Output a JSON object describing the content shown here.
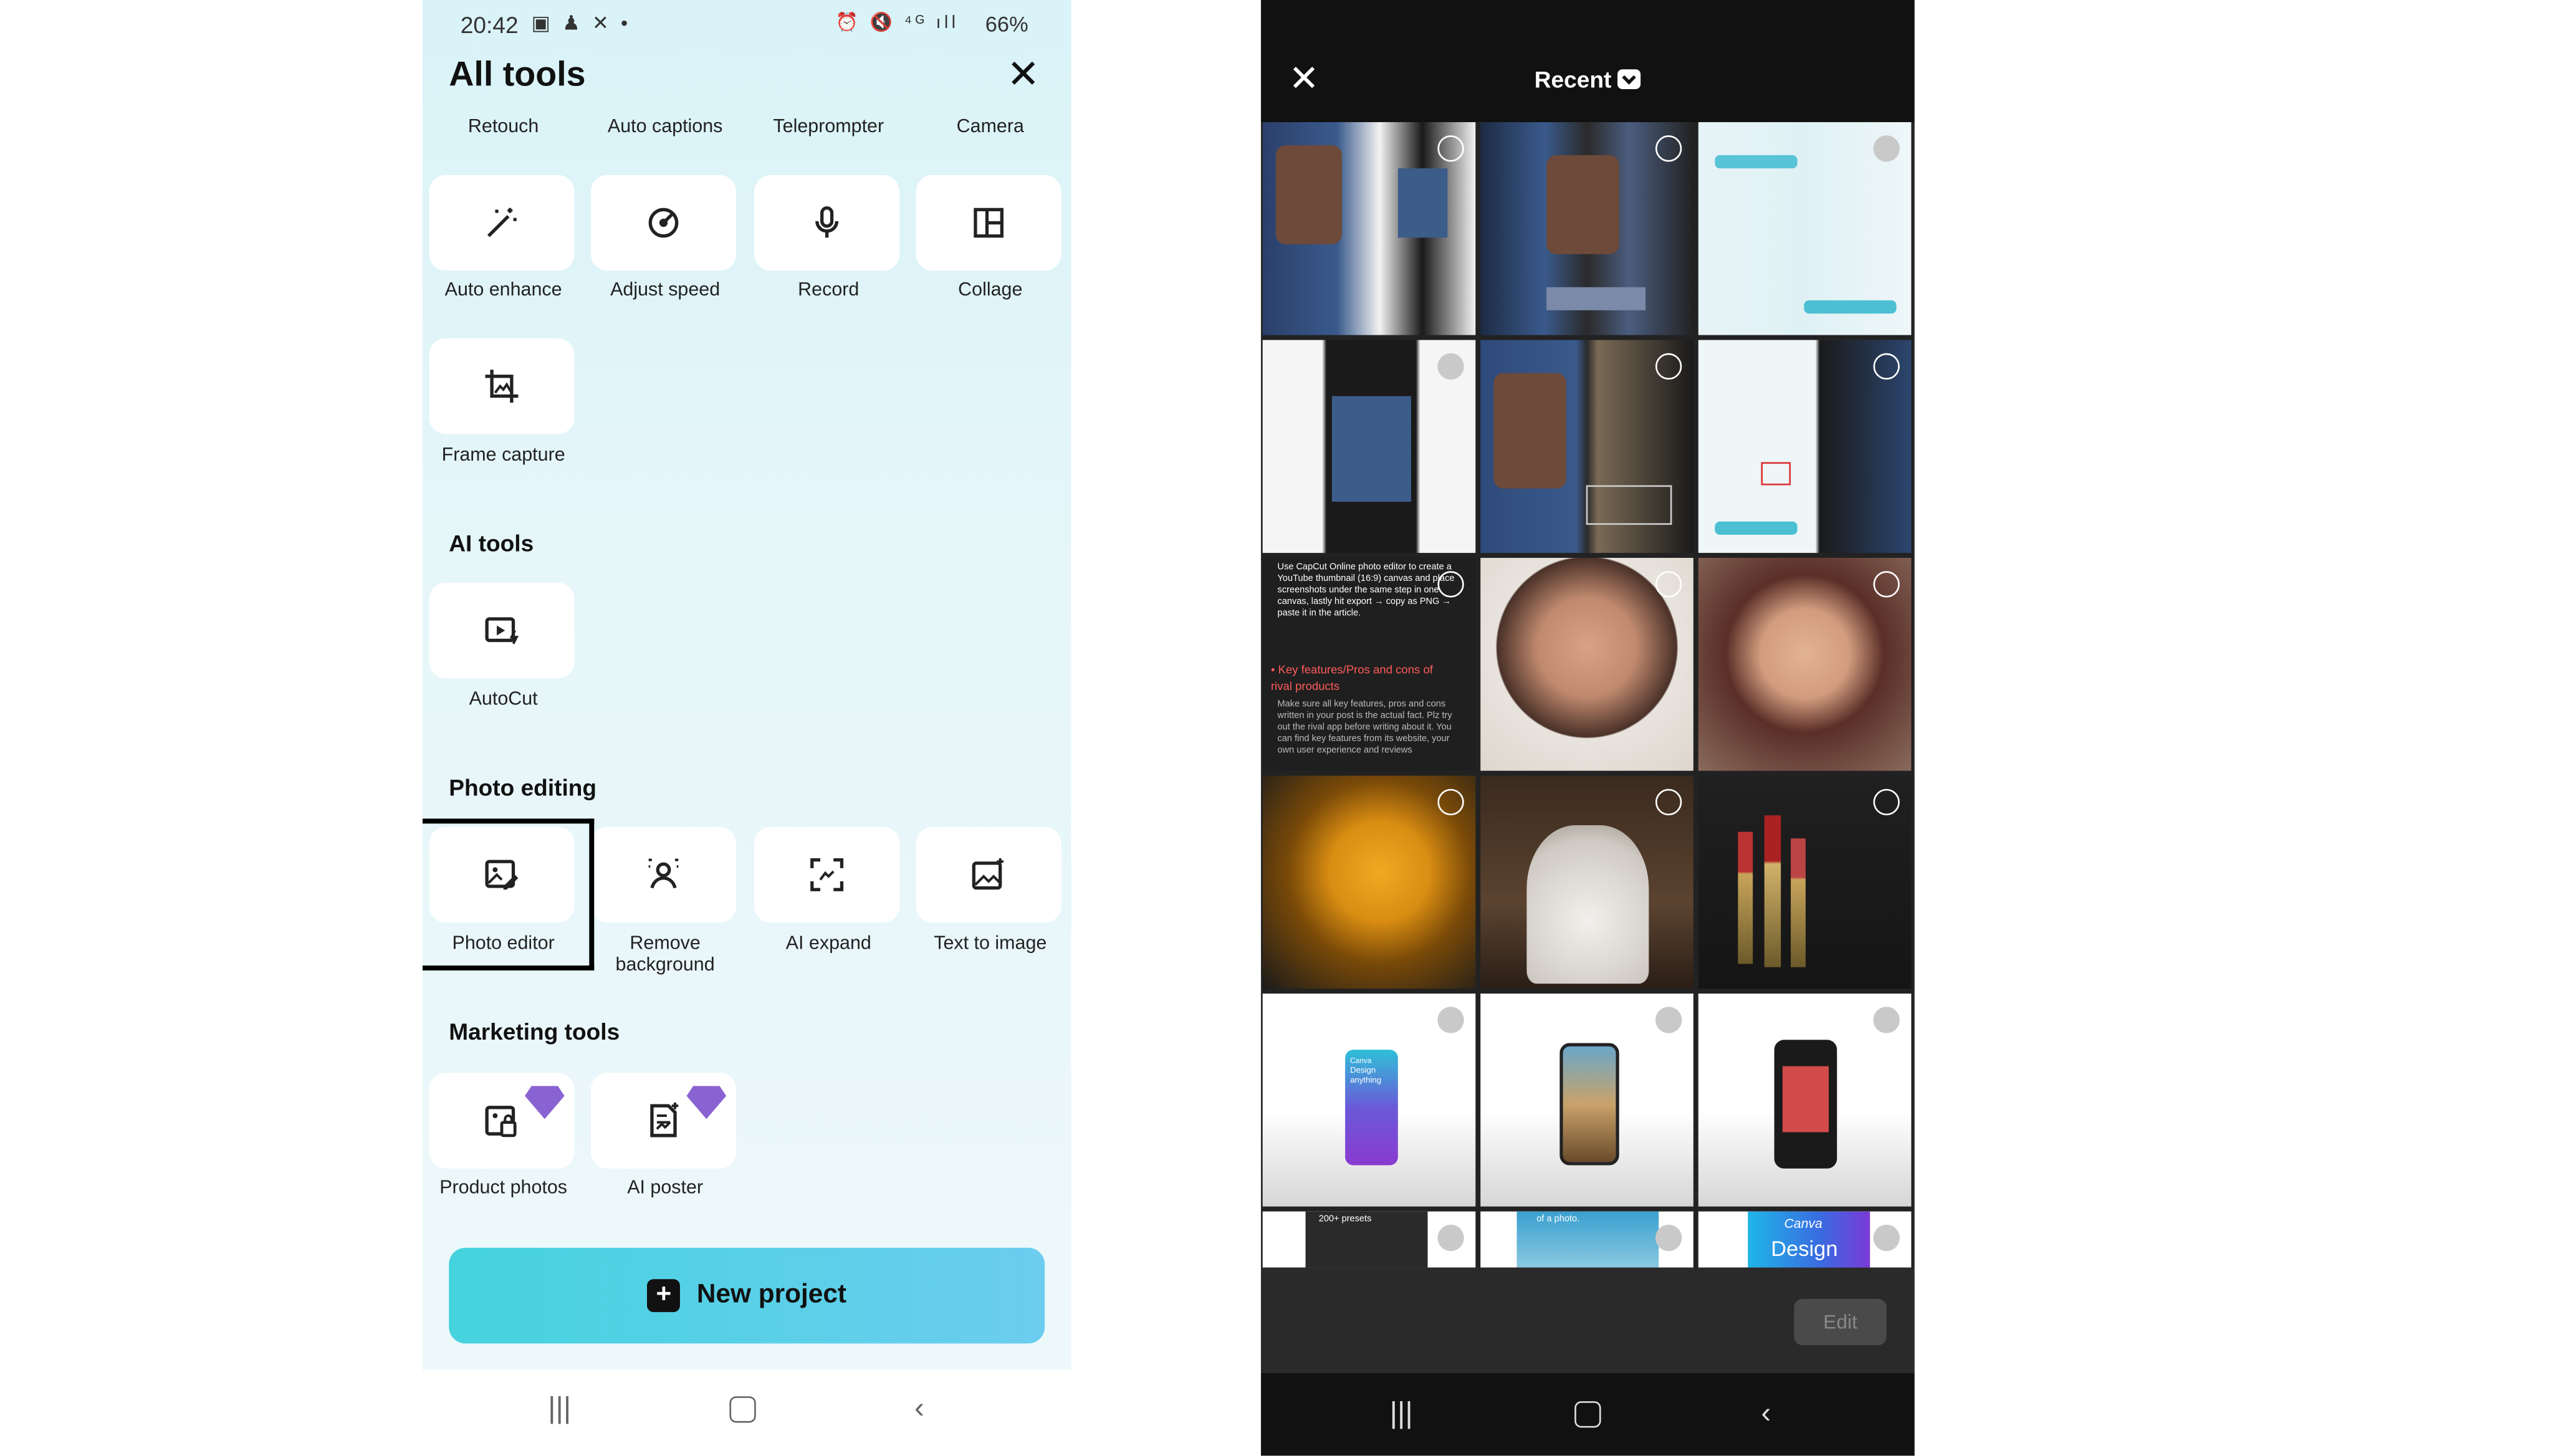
{
  "left": {
    "status": {
      "time": "20:42",
      "battery": "66%"
    },
    "title": "All tools",
    "top_labels": [
      "Retouch",
      "Auto captions",
      "Teleprompter",
      "Camera"
    ],
    "row1": [
      {
        "label": "Auto enhance",
        "icon": "magic-wand-icon"
      },
      {
        "label": "Adjust speed",
        "icon": "speed-icon"
      },
      {
        "label": "Record",
        "icon": "microphone-icon"
      },
      {
        "label": "Collage",
        "icon": "collage-icon"
      }
    ],
    "row2": [
      {
        "label": "Frame capture",
        "icon": "crop-image-icon"
      }
    ],
    "sections": {
      "ai_tools": "AI tools",
      "photo_editing": "Photo editing",
      "marketing_tools": "Marketing tools"
    },
    "ai": [
      {
        "label": "AutoCut",
        "icon": "autocut-icon"
      }
    ],
    "photo": [
      {
        "label": "Photo editor",
        "icon": "photo-edit-icon"
      },
      {
        "label": "Remove background",
        "icon": "remove-bg-icon"
      },
      {
        "label": "AI expand",
        "icon": "expand-icon"
      },
      {
        "label": "Text to image",
        "icon": "text-to-image-icon"
      }
    ],
    "marketing": [
      {
        "label": "Product photos",
        "icon": "product-photo-icon"
      },
      {
        "label": "AI poster",
        "icon": "poster-icon"
      }
    ],
    "new_project": "New project",
    "accent": "#4fd0e4",
    "premium_color": "#8a63d2"
  },
  "right": {
    "title": "Recent",
    "edit": "Edit",
    "thumb_texts": {
      "article_body_1": "Use CapCut Online photo editor to create a YouTube thumbnail (16:9) canvas and place screenshots under the same step in one canvas, lastly hit export → copy as PNG → paste it in the article.",
      "article_heading": "• Key features/Pros and cons of rival products",
      "article_body_2": "Make sure all key features, pros and cons written in your post is the actual fact. Plz try out the rival app before writing about it. You can find key features from its website, your own user experience and reviews",
      "presets": "200+ presets",
      "of_a_photo": "of a photo.",
      "canva": "Canva",
      "design": "Design",
      "phone_canva_1": "Canva",
      "phone_canva_2": "Design anything"
    }
  }
}
